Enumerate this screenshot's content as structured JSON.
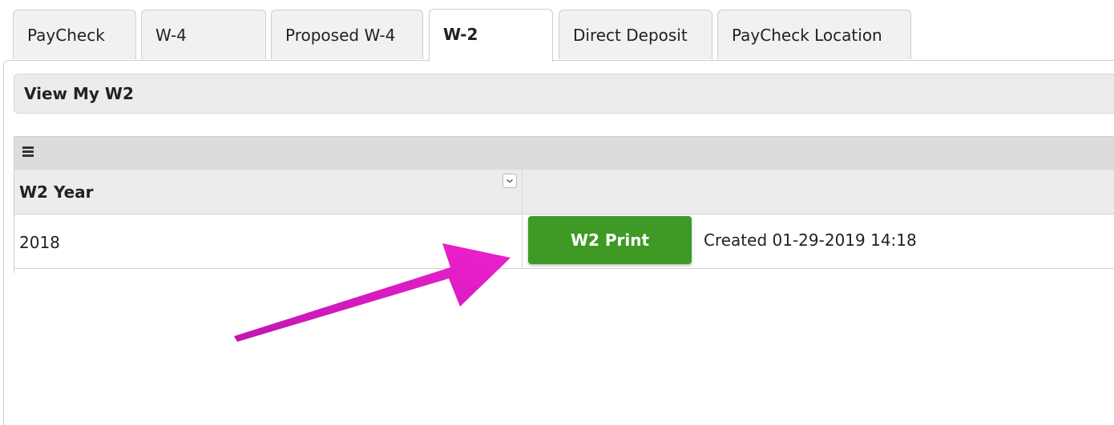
{
  "tabs": [
    {
      "label": "PayCheck"
    },
    {
      "label": "W-4"
    },
    {
      "label": "Proposed W-4"
    },
    {
      "label": "W-2"
    },
    {
      "label": "Direct Deposit"
    },
    {
      "label": "PayCheck Location"
    }
  ],
  "active_tab": "W-2",
  "section": {
    "title": "View My W2"
  },
  "grid": {
    "menu_icon": "hamburger-menu-icon",
    "columns": [
      {
        "label": "W2 Year"
      },
      {
        "label": ""
      }
    ],
    "sort_icon": "chevron-down-icon",
    "rows": [
      {
        "year": "2018",
        "action_label": "W2 Print",
        "created": "Created 01-29-2019 14:18"
      }
    ]
  },
  "annotation": {
    "icon": "pointer-arrow-icon"
  },
  "colors": {
    "print_button": "#3f9a25",
    "arrow": "#e21ac4"
  }
}
